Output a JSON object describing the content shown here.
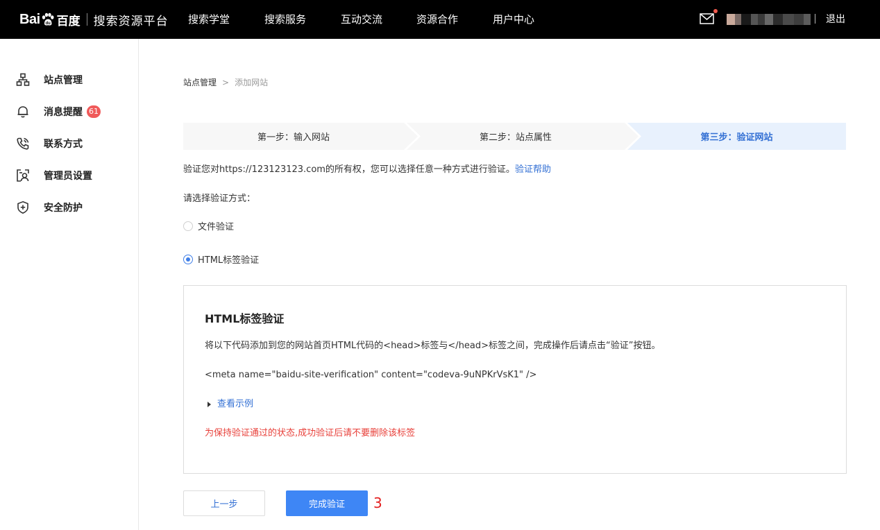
{
  "header": {
    "logo_bai": "Bai",
    "logo_du": "du",
    "logo_cn": "百度",
    "platform_title": "搜索资源平台",
    "nav": [
      "搜索学堂",
      "搜索服务",
      "互动交流",
      "资源合作",
      "用户中心"
    ],
    "logout": "退出"
  },
  "sidebar": {
    "items": [
      {
        "label": "站点管理",
        "icon": "sitemap-icon"
      },
      {
        "label": "消息提醒",
        "icon": "bell-icon",
        "badge": "61"
      },
      {
        "label": "联系方式",
        "icon": "phone-icon"
      },
      {
        "label": "管理员设置",
        "icon": "admin-icon"
      },
      {
        "label": "安全防护",
        "icon": "shield-plus-icon"
      }
    ]
  },
  "breadcrumb": {
    "root": "站点管理",
    "separator": ">",
    "current": "添加网站"
  },
  "steps": [
    {
      "label": "第一步：输入网站",
      "active": false
    },
    {
      "label": "第二步：站点属性",
      "active": false
    },
    {
      "label": "第三步：验证网站",
      "active": true
    }
  ],
  "verify": {
    "intro": "验证您对https://123123123.com的所有权，您可以选择任意一种方式进行验证。",
    "help_link": "验证帮助",
    "choose_label": "请选择验证方式：",
    "options": [
      {
        "label": "文件验证",
        "selected": false
      },
      {
        "label": "HTML标签验证",
        "selected": true
      }
    ],
    "panel": {
      "title": "HTML标签验证",
      "description": "将以下代码添加到您的网站首页HTML代码的<head>标签与</head>标签之间，完成操作后请点击“验证”按钮。",
      "code": "<meta name=\"baidu-site-verification\" content=\"codeva-9uNPKrVsK1\" />",
      "example_link": "查看示例",
      "warning": "为保持验证通过的状态,成功验证后请不要删除该标签"
    }
  },
  "buttons": {
    "prev": "上一步",
    "finish": "完成验证"
  },
  "annotation": "3",
  "colors": {
    "topbar": "#000000",
    "accent": "#3e86f5",
    "link": "#3370d4",
    "warning": "#e8403a",
    "badge": "#f05a5a",
    "step_active_bg": "#e8f1fd",
    "step_inactive_bg": "#f7f7f7"
  }
}
